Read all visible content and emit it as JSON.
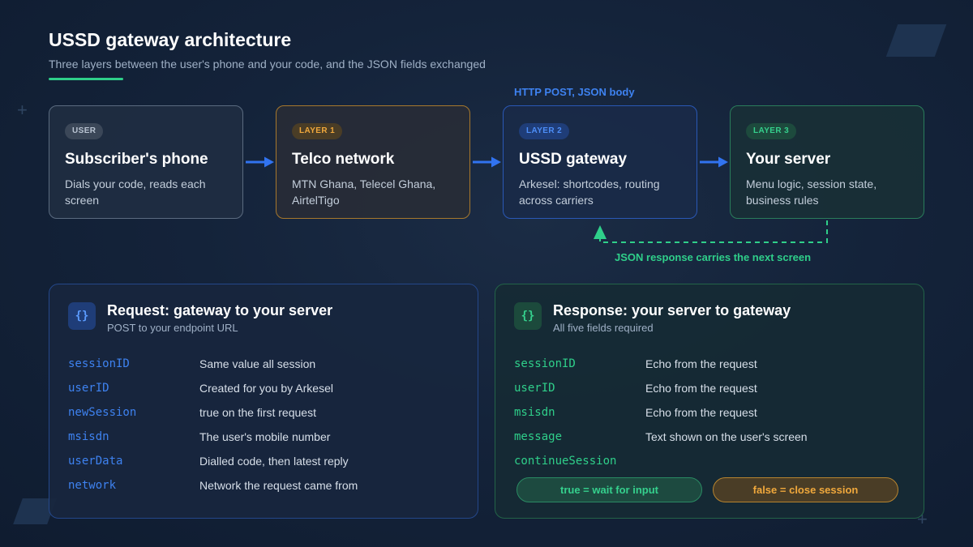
{
  "header": {
    "title": "USSD gateway architecture",
    "subtitle": "Three layers between the user's phone and your code, and the JSON fields exchanged"
  },
  "flow": {
    "above_label": "HTTP POST, JSON body",
    "return_label": "JSON response carries the next screen",
    "cards": [
      {
        "badge": "USER",
        "title": "Subscriber's phone",
        "desc": "Dials your code, reads each screen"
      },
      {
        "badge": "LAYER 1",
        "title": "Telco network",
        "desc": "MTN Ghana, Telecel Ghana, AirtelTigo"
      },
      {
        "badge": "LAYER 2",
        "title": "USSD gateway",
        "desc": "Arkesel: shortcodes, routing across carriers"
      },
      {
        "badge": "LAYER 3",
        "title": "Your server",
        "desc": "Menu logic, session state, business rules"
      }
    ]
  },
  "request": {
    "icon": "{}",
    "title": "Request: gateway to your server",
    "subtitle": "POST to your endpoint URL",
    "fields": [
      {
        "name": "sessionID",
        "desc": "Same value all session"
      },
      {
        "name": "userID",
        "desc": "Created for you by Arkesel"
      },
      {
        "name": "newSession",
        "desc": "true on the first request"
      },
      {
        "name": "msisdn",
        "desc": "The user's mobile number"
      },
      {
        "name": "userData",
        "desc": "Dialled code, then latest reply"
      },
      {
        "name": "network",
        "desc": "Network the request came from"
      }
    ]
  },
  "response": {
    "icon": "{}",
    "title": "Response: your server to gateway",
    "subtitle": "All five fields required",
    "fields": [
      {
        "name": "sessionID",
        "desc": "Echo from the request"
      },
      {
        "name": "userID",
        "desc": "Echo from the request"
      },
      {
        "name": "msisdn",
        "desc": "Echo from the request"
      },
      {
        "name": "message",
        "desc": "Text shown on the user's screen"
      },
      {
        "name": "continueSession",
        "desc": ""
      }
    ],
    "pills": {
      "true_label": "true = wait for input",
      "false_label": "false = close session"
    }
  },
  "colors": {
    "background": "#14233a",
    "accent_blue": "#3e82f0",
    "accent_green": "#2fcf8a",
    "accent_amber": "#f0a83c"
  }
}
